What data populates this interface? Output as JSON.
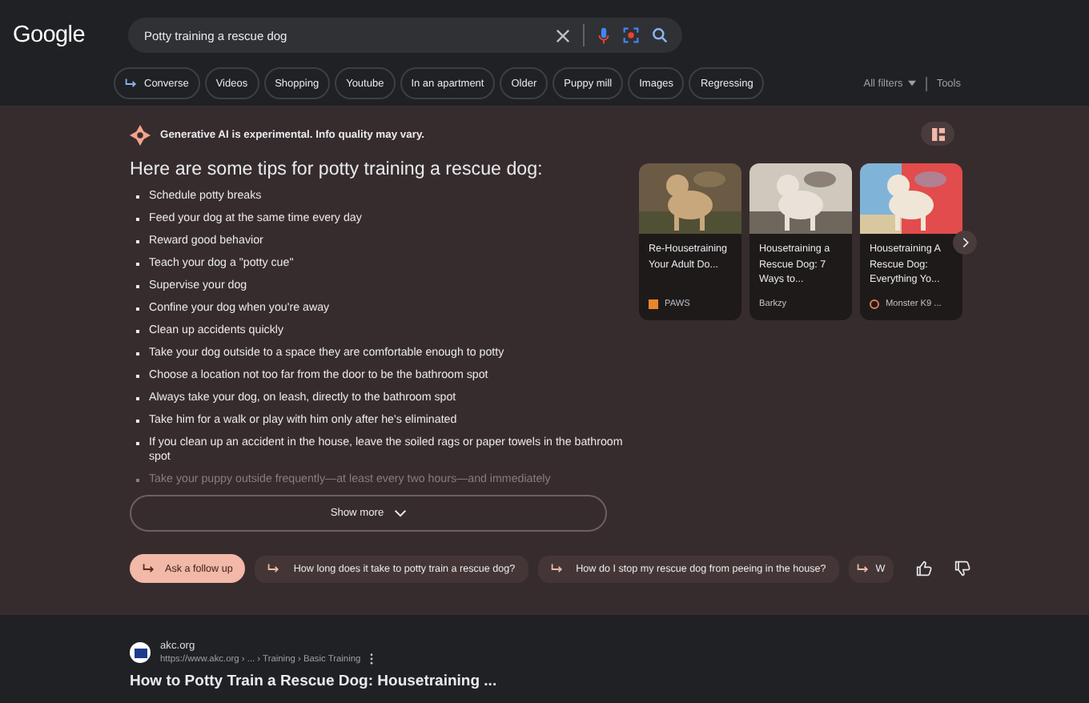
{
  "header": {
    "logo": "Google",
    "search": {
      "value": "Potty training a rescue dog"
    },
    "chips": [
      {
        "label": "Converse",
        "kind": "converse"
      },
      {
        "label": "Videos",
        "kind": "plain"
      },
      {
        "label": "Shopping",
        "kind": "plain"
      },
      {
        "label": "Youtube",
        "kind": "plain"
      },
      {
        "label": "In an apartment",
        "kind": "plain"
      },
      {
        "label": "Older",
        "kind": "plain"
      },
      {
        "label": "Puppy mill",
        "kind": "plain"
      },
      {
        "label": "Images",
        "kind": "plain"
      },
      {
        "label": "Regressing",
        "kind": "plain"
      }
    ],
    "all_filters": "All filters",
    "tools": "Tools"
  },
  "ai_overview": {
    "notice": "Generative AI is experimental. Info quality may vary.",
    "heading": "Here are some tips for potty training a rescue dog:",
    "items": [
      "Schedule potty breaks",
      "Feed your dog at the same time every day",
      "Reward good behavior",
      "Teach your dog a \"potty cue\"",
      "Supervise your dog",
      "Confine your dog when you're away",
      "Clean up accidents quickly",
      "Take your dog outside to a space they are comfortable enough to potty",
      "Choose a location not too far from the door to be the bathroom spot",
      "Always take your dog, on leash, directly to the bathroom spot",
      "Take him for a walk or play with him only after he's eliminated",
      "If you clean up an accident in the house, leave the soiled rags or paper towels in the bathroom spot"
    ],
    "faded_item": "Take your puppy outside frequently—at least every two hours—and immediately",
    "show_more": "Show more",
    "cards": [
      {
        "title": "Re-Housetraining Your Adult Do...",
        "source": "PAWS",
        "kind": "square"
      },
      {
        "title": "Housetraining a Rescue Dog: 7 Ways to...",
        "source": "Barkzy",
        "kind": "plain"
      },
      {
        "title": "Housetraining A Rescue Dog: Everything Yo...",
        "source": "Monster K9 ...",
        "kind": "ring"
      }
    ],
    "follow_up": "Ask a follow up",
    "suggestions": [
      "How long does it take to potty train a rescue dog?",
      "How do I stop my rescue dog from peeing in the house?",
      "W"
    ]
  },
  "result": {
    "site": "akc.org",
    "url": "https://www.akc.org › ... › Training › Basic Training",
    "title": "How to Potty Train a Rescue Dog: Housetraining ..."
  }
}
